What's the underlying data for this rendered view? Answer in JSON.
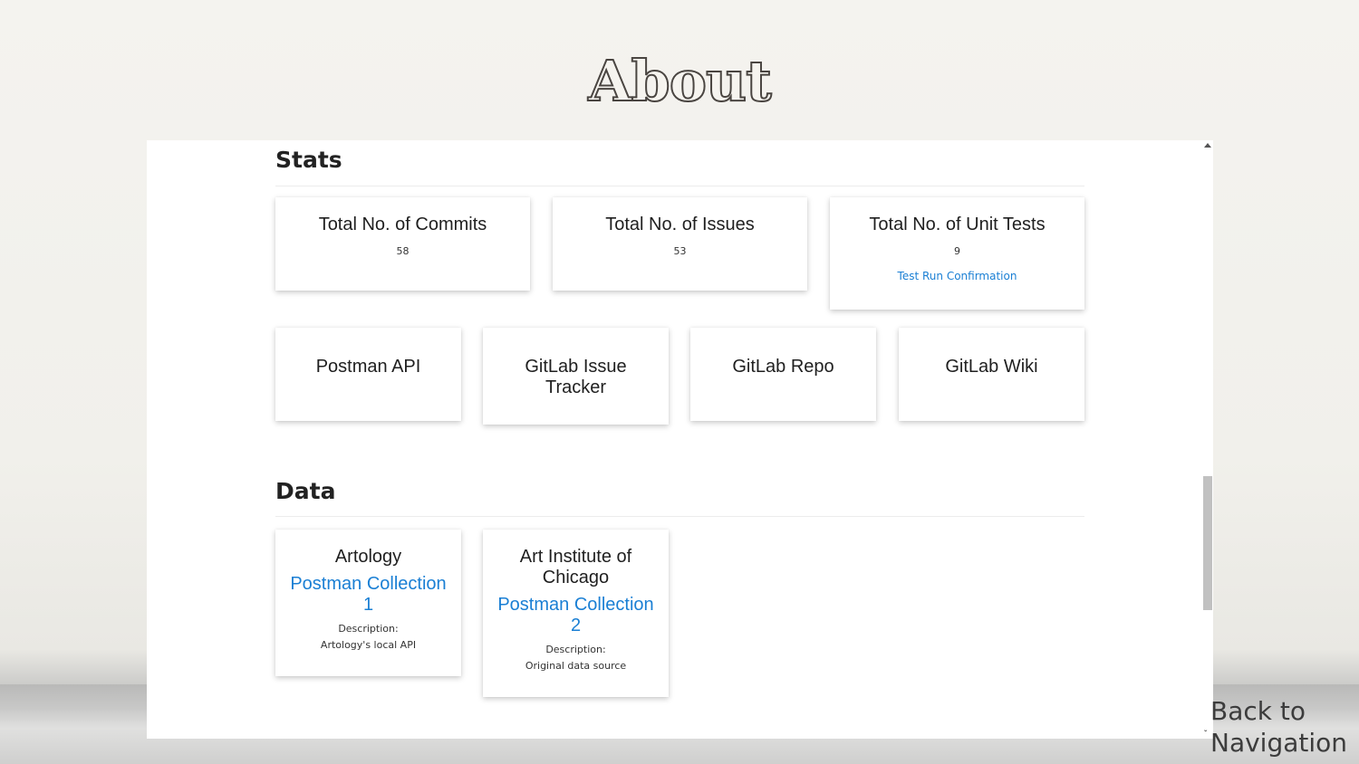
{
  "page": {
    "title": "About",
    "back_to_navigation": "Back to Navigation"
  },
  "stats": {
    "heading": "Stats",
    "cards": [
      {
        "title": "Total No. of Commits",
        "value": "58"
      },
      {
        "title": "Total No. of Issues",
        "value": "53"
      },
      {
        "title": "Total No. of Unit Tests",
        "value": "9",
        "link": "Test Run Confirmation"
      }
    ],
    "links": [
      {
        "label": "Postman API"
      },
      {
        "label": "GitLab Issue Tracker"
      },
      {
        "label": "GitLab Repo"
      },
      {
        "label": "GitLab Wiki"
      }
    ]
  },
  "data": {
    "heading": "Data",
    "cards": [
      {
        "title": "Artology",
        "link": "Postman Collection 1",
        "desc_label": "Description:",
        "desc": "Artology's local API"
      },
      {
        "title": "Art Institute of Chicago",
        "link": "Postman Collection 2",
        "desc_label": "Description:",
        "desc": "Original data source"
      }
    ]
  },
  "colors": {
    "link": "#1a7fd4",
    "heading": "#222222",
    "title_outline": "#4a4541"
  }
}
